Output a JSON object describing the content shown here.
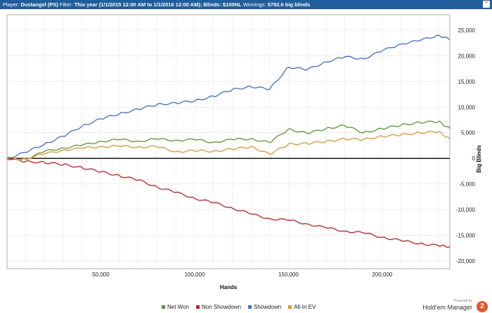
{
  "header": {
    "player_label": "Player:",
    "player": "Dustangel (PS)",
    "filter_label": "Filter:",
    "filter": "This year (1/1/2015 12:00 AM to 1/1/2016 12:00 AM); Blinds: $100NL",
    "winnings_label": "Winnings:",
    "winnings": "5782.6 big blinds",
    "collapse_glyph": "⌃"
  },
  "footer": {
    "powered_by": "Powered by",
    "brand": "Hold'em Manager",
    "logo_text": "2"
  },
  "chart_data": {
    "type": "line",
    "xlabel": "Hands",
    "ylabel": "Big Blinds",
    "xlim": [
      0,
      236000
    ],
    "ylim": [
      -21500,
      28000
    ],
    "x_ticks": [
      50000,
      100000,
      150000,
      200000
    ],
    "x_tick_labels": [
      "50,000",
      "100,000",
      "150,000",
      "200,000"
    ],
    "y_ticks": [
      25000,
      20000,
      15000,
      10000,
      5000,
      0,
      -5000,
      -10000,
      -15000,
      -20000
    ],
    "y_tick_labels": [
      "25,000",
      "20,000",
      "15,000",
      "10,000",
      "5,000",
      "0",
      "-5,000",
      "-10,000",
      "-15,000",
      "-20,000"
    ],
    "grid": true,
    "legend_position": "bottom",
    "series": [
      {
        "name": "Net Won",
        "color": "#5a9a2a",
        "points": [
          [
            0,
            0
          ],
          [
            10000,
            -200
          ],
          [
            20000,
            1400
          ],
          [
            30000,
            2000
          ],
          [
            40000,
            2600
          ],
          [
            50000,
            3300
          ],
          [
            60000,
            3700
          ],
          [
            70000,
            3300
          ],
          [
            80000,
            3800
          ],
          [
            90000,
            3500
          ],
          [
            100000,
            3700
          ],
          [
            110000,
            3100
          ],
          [
            120000,
            3700
          ],
          [
            130000,
            3800
          ],
          [
            140000,
            3100
          ],
          [
            150000,
            5700
          ],
          [
            160000,
            4900
          ],
          [
            170000,
            5800
          ],
          [
            180000,
            6400
          ],
          [
            190000,
            5000
          ],
          [
            200000,
            5800
          ],
          [
            210000,
            6500
          ],
          [
            220000,
            7000
          ],
          [
            230000,
            7200
          ],
          [
            236000,
            5800
          ]
        ]
      },
      {
        "name": "Non Showdown",
        "color": "#e01a1a",
        "points": [
          [
            0,
            0
          ],
          [
            10000,
            -600
          ],
          [
            20000,
            -800
          ],
          [
            30000,
            -1200
          ],
          [
            40000,
            -1800
          ],
          [
            50000,
            -2600
          ],
          [
            60000,
            -3400
          ],
          [
            70000,
            -4200
          ],
          [
            80000,
            -5600
          ],
          [
            90000,
            -6600
          ],
          [
            100000,
            -7800
          ],
          [
            110000,
            -8600
          ],
          [
            120000,
            -9700
          ],
          [
            130000,
            -10800
          ],
          [
            140000,
            -11800
          ],
          [
            150000,
            -12000
          ],
          [
            160000,
            -12800
          ],
          [
            170000,
            -13500
          ],
          [
            180000,
            -14200
          ],
          [
            190000,
            -14500
          ],
          [
            200000,
            -15400
          ],
          [
            210000,
            -16000
          ],
          [
            220000,
            -16600
          ],
          [
            230000,
            -17000
          ],
          [
            236000,
            -17200
          ]
        ]
      },
      {
        "name": "Showdown",
        "color": "#3a6ee8",
        "points": [
          [
            0,
            0
          ],
          [
            10000,
            1200
          ],
          [
            20000,
            2800
          ],
          [
            30000,
            4300
          ],
          [
            40000,
            6300
          ],
          [
            50000,
            7700
          ],
          [
            60000,
            8700
          ],
          [
            70000,
            9600
          ],
          [
            80000,
            10500
          ],
          [
            90000,
            10800
          ],
          [
            100000,
            11200
          ],
          [
            110000,
            12100
          ],
          [
            120000,
            13400
          ],
          [
            130000,
            14000
          ],
          [
            140000,
            13500
          ],
          [
            150000,
            17800
          ],
          [
            160000,
            17300
          ],
          [
            170000,
            18800
          ],
          [
            180000,
            19800
          ],
          [
            190000,
            19400
          ],
          [
            200000,
            21000
          ],
          [
            210000,
            22300
          ],
          [
            220000,
            23000
          ],
          [
            230000,
            24000
          ],
          [
            236000,
            23200
          ]
        ]
      },
      {
        "name": "All-In EV",
        "color": "#f0922e",
        "points": [
          [
            0,
            0
          ],
          [
            10000,
            -100
          ],
          [
            20000,
            900
          ],
          [
            30000,
            1600
          ],
          [
            40000,
            2000
          ],
          [
            50000,
            2300
          ],
          [
            60000,
            2400
          ],
          [
            70000,
            2200
          ],
          [
            80000,
            2300
          ],
          [
            90000,
            1300
          ],
          [
            100000,
            1500
          ],
          [
            110000,
            1400
          ],
          [
            120000,
            1800
          ],
          [
            130000,
            2300
          ],
          [
            140000,
            800
          ],
          [
            150000,
            2800
          ],
          [
            160000,
            2900
          ],
          [
            170000,
            3300
          ],
          [
            180000,
            3800
          ],
          [
            190000,
            3700
          ],
          [
            200000,
            4300
          ],
          [
            210000,
            4600
          ],
          [
            220000,
            5000
          ],
          [
            230000,
            5200
          ],
          [
            236000,
            3800
          ]
        ]
      }
    ]
  }
}
